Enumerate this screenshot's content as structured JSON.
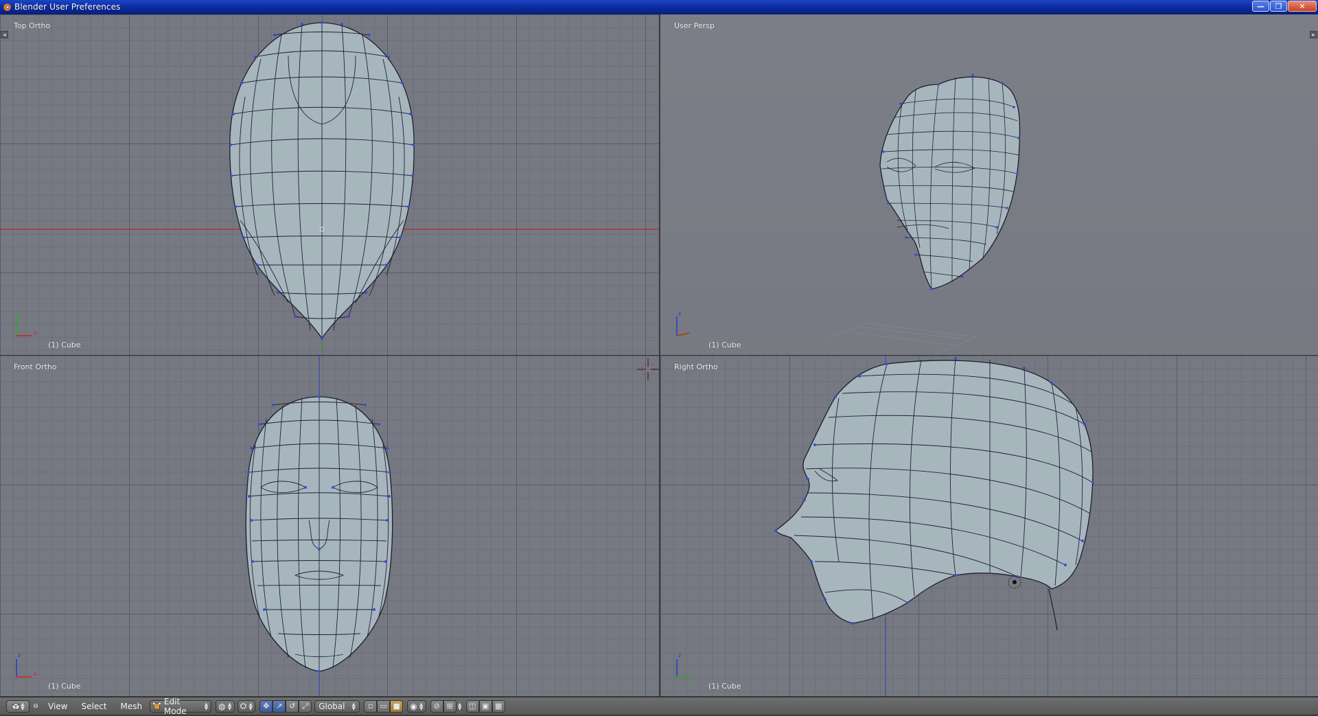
{
  "window": {
    "title": "Blender User Preferences",
    "minimize_glyph": "—",
    "maximize_glyph": "❐",
    "close_glyph": "✕"
  },
  "viewports": {
    "top_left": {
      "label": "Top Ortho",
      "object": "(1) Cube",
      "axis_1": "x",
      "axis_2": ""
    },
    "top_right": {
      "label": "User Persp",
      "object": "(1) Cube",
      "axis_1": "z",
      "axis_2": ""
    },
    "bottom_left": {
      "label": "Front Ortho",
      "object": "(1) Cube",
      "axis_1": "z",
      "axis_2": "x"
    },
    "bottom_right": {
      "label": "Right Ortho",
      "object": "(1) Cube",
      "axis_1": "z",
      "axis_2": ""
    }
  },
  "header": {
    "menus": [
      "View",
      "Select",
      "Mesh"
    ],
    "mode": "Edit Mode",
    "orientation": "Global"
  },
  "colors": {
    "viewport_bg": "#777982",
    "mesh_fill": "#a7b5bd",
    "wire": "#1c1c30",
    "vertex": "#3a4cd8",
    "x_axis": "#d02020",
    "y_axis": "#20b020",
    "z_axis": "#1a3fd0"
  },
  "icons": {
    "editor_type": "3d-view-icon",
    "mode": "edit-mode-icon",
    "pivot": "pivot-icon",
    "snap": "magnet-icon",
    "render": "render-icon"
  }
}
